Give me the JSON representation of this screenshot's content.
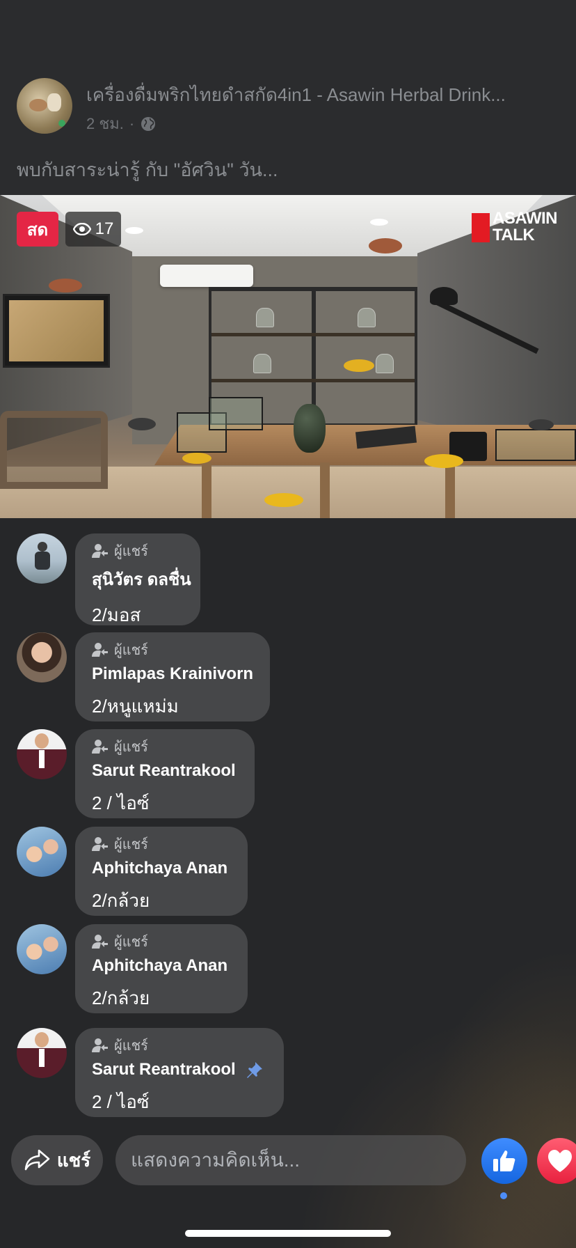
{
  "post": {
    "page_name": "เครื่องดื่มพริกไทยดำสกัด4in1 - Asawin Herbal Drink...",
    "time": "2 ชม.",
    "separator": "·",
    "privacy_icon": "globe-icon",
    "text": "พบกับสาระน่ารู้ กับ \"อัศวิน\" วัน..."
  },
  "video": {
    "live_label": "สด",
    "viewer_count": "17",
    "brand_line1": "ASAWIN",
    "brand_line2": "TALK",
    "brand_color": "#e31b23",
    "live_color": "#e42645"
  },
  "comments": [
    {
      "role": "ผู้แชร์",
      "name": "สุนิวัตร ดลชื่น",
      "text": "2/มอส",
      "pinned": false
    },
    {
      "role": "ผู้แชร์",
      "name": "Pimlapas Krainivorn",
      "text": "2/หนูแหม่ม",
      "pinned": false
    },
    {
      "role": "ผู้แชร์",
      "name": "Sarut Reantrakool",
      "text": "2 / ไอซ์",
      "pinned": false
    },
    {
      "role": "ผู้แชร์",
      "name": "Aphitchaya Anan",
      "text": "2/กล้วย",
      "pinned": false
    },
    {
      "role": "ผู้แชร์",
      "name": "Aphitchaya Anan",
      "text": "2/กล้วย",
      "pinned": false
    },
    {
      "role": "ผู้แชร์",
      "name": "Sarut Reantrakool",
      "text": "2 / ไอซ์",
      "pinned": true
    }
  ],
  "bottom_bar": {
    "share_label": "แชร์",
    "comment_placeholder": "แสดงความคิดเห็น...",
    "like_color": "#1877f2",
    "love_color": "#f33e58"
  }
}
